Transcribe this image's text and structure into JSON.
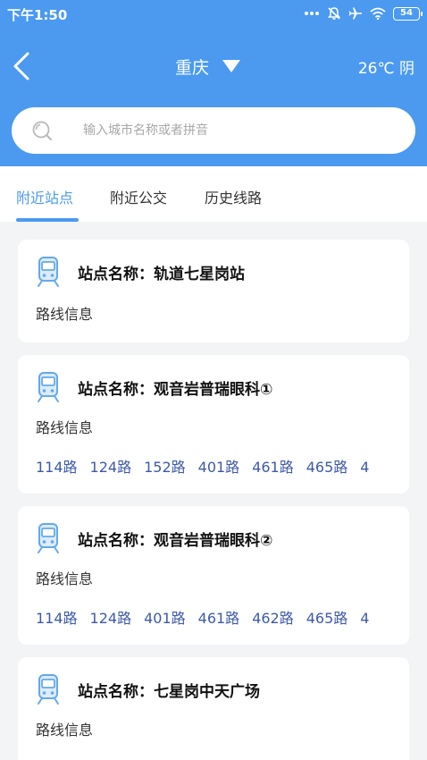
{
  "status_bar": {
    "time": "下午1:50",
    "battery": "54"
  },
  "nav": {
    "city": "重庆",
    "weather": "26℃ 阴"
  },
  "search": {
    "placeholder": "输入城市名称或者拼音"
  },
  "tabs": [
    {
      "label": "附近站点",
      "active": true
    },
    {
      "label": "附近公交",
      "active": false
    },
    {
      "label": "历史线路",
      "active": false
    }
  ],
  "stations": [
    {
      "title": "站点名称：轨道七星岗站",
      "route_label": "路线信息",
      "routes": []
    },
    {
      "title": "站点名称：观音岩普瑞眼科①",
      "route_label": "路线信息",
      "routes": [
        "114路",
        "124路",
        "152路",
        "401路",
        "461路",
        "465路",
        "4"
      ]
    },
    {
      "title": "站点名称：观音岩普瑞眼科②",
      "route_label": "路线信息",
      "routes": [
        "114路",
        "124路",
        "401路",
        "461路",
        "462路",
        "465路",
        "4"
      ]
    },
    {
      "title": "站点名称：七星岗中天广场",
      "route_label": "路线信息",
      "routes": []
    }
  ],
  "colors": {
    "header": "#4b9af0",
    "accent": "#4b9af0",
    "route_link": "#3d5aa8"
  },
  "icons": [
    "back-arrow-icon",
    "dropdown-triangle-icon",
    "search-icon",
    "train-icon"
  ]
}
